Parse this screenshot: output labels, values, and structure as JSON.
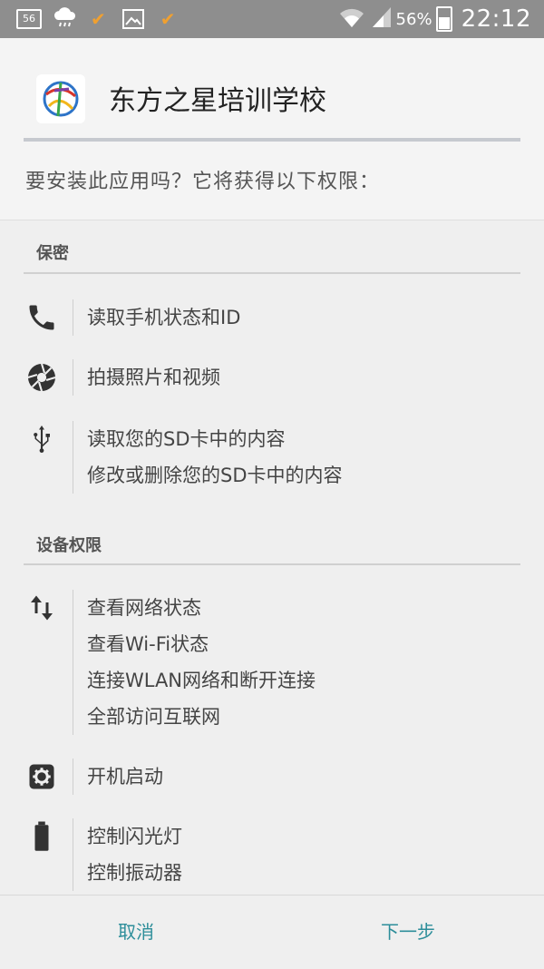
{
  "status_bar": {
    "notification_badge": "56",
    "battery_percent": "56%",
    "time": "22:12"
  },
  "app": {
    "title": "东方之星培训学校",
    "install_prompt": "要安装此应用吗？它将获得以下权限："
  },
  "sections": {
    "privacy": {
      "title": "保密",
      "items": [
        {
          "icon": "phone-icon",
          "lines": [
            "读取手机状态和ID"
          ]
        },
        {
          "icon": "camera-icon",
          "lines": [
            "拍摄照片和视频"
          ]
        },
        {
          "icon": "usb-icon",
          "lines": [
            "读取您的SD卡中的内容",
            "修改或删除您的SD卡中的内容"
          ]
        }
      ]
    },
    "device": {
      "title": "设备权限",
      "items": [
        {
          "icon": "network-arrows-icon",
          "lines": [
            "查看网络状态",
            "查看Wi-Fi状态",
            "连接WLAN网络和断开连接",
            "全部访问互联网"
          ]
        },
        {
          "icon": "gear-icon",
          "lines": [
            "开机启动"
          ]
        },
        {
          "icon": "battery-icon",
          "lines": [
            "控制闪光灯",
            "控制振动器"
          ]
        }
      ]
    }
  },
  "buttons": {
    "cancel": "取消",
    "next": "下一步"
  },
  "colors": {
    "status_bar": "#8e8e8e",
    "button_text": "#2d8e9a",
    "notification_check": "#f0a030"
  }
}
